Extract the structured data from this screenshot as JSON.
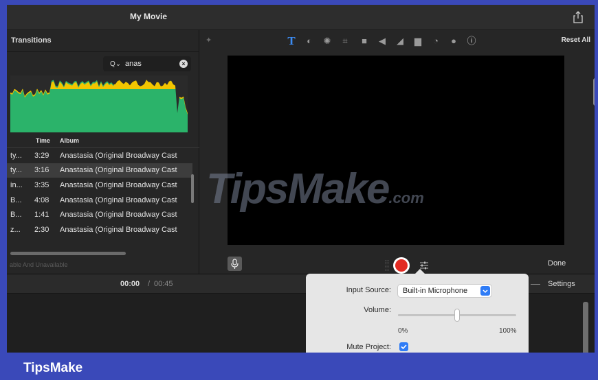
{
  "window": {
    "title": "My Movie"
  },
  "browser": {
    "section_title": "Transitions",
    "search": {
      "value": "anas",
      "placeholder": ""
    },
    "columns": {
      "time": "Time",
      "album": "Album"
    },
    "rows": [
      {
        "title": "ty...",
        "time": "3:29",
        "album": "Anastasia (Original Broadway Cast",
        "selected": false
      },
      {
        "title": "ty...",
        "time": "3:16",
        "album": "Anastasia (Original Broadway Cast",
        "selected": true
      },
      {
        "title": "in...",
        "time": "3:35",
        "album": "Anastasia (Original Broadway Cast",
        "selected": false
      },
      {
        "title": "B...",
        "time": "4:08",
        "album": "Anastasia (Original Broadway Cast",
        "selected": false
      },
      {
        "title": "B...",
        "time": "1:41",
        "album": "Anastasia (Original Broadway Cast",
        "selected": false
      },
      {
        "title": "z...",
        "time": "2:30",
        "album": "Anastasia (Original Broadway Cast",
        "selected": false
      }
    ],
    "footer": "able And Unavailable"
  },
  "viewer": {
    "reset_label": "Reset All",
    "done_label": "Done",
    "title_tool_glyph": "T"
  },
  "timeline": {
    "current": "00:00",
    "separator": "/",
    "total": "00:45",
    "settings_label": "Settings"
  },
  "voiceover_popover": {
    "input_source_label": "Input Source:",
    "input_source_value": "Built-in Microphone",
    "volume_label": "Volume:",
    "volume_level": 0.5,
    "volume_min": "0%",
    "volume_max": "100%",
    "mute_label": "Mute Project:",
    "mute_checked": true
  },
  "watermark": {
    "text": "TipsMake",
    "suffix": ".com"
  },
  "brand": {
    "text": "TipsMake"
  },
  "colors": {
    "accent": "#2f7cf6",
    "record": "#e22a22",
    "waveform": "#2bb36a",
    "waveform_peak": "#f2c500",
    "frame": "#3a49b9"
  }
}
